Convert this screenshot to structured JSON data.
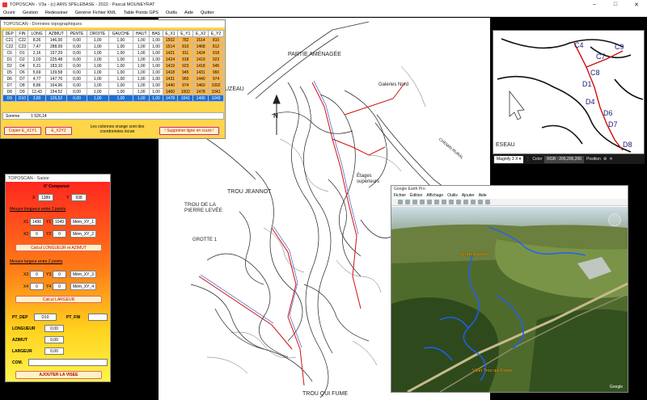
{
  "app": {
    "title": "TOPOSCAN - V3a - (c) ARIS SPELEBASE - 2022 - Pascal MOUNEYRAT",
    "menu": [
      "Ouvrir",
      "Gestion",
      "Redessiner",
      "Générer Fichier KML",
      "Table Points GPS",
      "Outils",
      "Aide",
      "Quitter"
    ]
  },
  "topo": {
    "title": "TOPOSCAN - Données topographiques",
    "columns": [
      "DEP",
      "FIN",
      "LONG",
      "AZIMUT",
      "PENTE",
      "DROITE",
      "GAUCHE",
      "HAUT",
      "BAS",
      "E_X1",
      "E_Y1",
      "E_X2",
      "E_Y2"
    ],
    "rows": [
      [
        "C21",
        "C22",
        "8,26",
        "146,00",
        "0,00",
        "1,00",
        "1,00",
        "1,00",
        "1,00",
        "1502",
        "782",
        "1514",
        "810"
      ],
      [
        "C22",
        "C23",
        "7,47",
        "288,09",
        "0,00",
        "1,00",
        "1,00",
        "1,00",
        "1,00",
        "1514",
        "810",
        "1468",
        "812"
      ],
      [
        "C6",
        "D1",
        "2,16",
        "157,29",
        "0,00",
        "1,00",
        "1,00",
        "1,00",
        "1,00",
        "1421",
        "911",
        "1424",
        "918"
      ],
      [
        "D1",
        "D2",
        "2,03",
        "225,48",
        "0,00",
        "1,00",
        "1,00",
        "1,00",
        "1,00",
        "1424",
        "918",
        "1419",
        "923"
      ],
      [
        "D2",
        "D4",
        "6,31",
        "183,10",
        "0,00",
        "1,00",
        "1,00",
        "1,00",
        "1,00",
        "1419",
        "923",
        "1418",
        "945"
      ],
      [
        "D5",
        "D6",
        "5,69",
        "139,58",
        "0,00",
        "1,00",
        "1,00",
        "1,00",
        "1,00",
        "1418",
        "945",
        "1431",
        "960"
      ],
      [
        "D6",
        "D7",
        "4,77",
        "147,76",
        "0,00",
        "1,00",
        "1,00",
        "1,00",
        "1,00",
        "1431",
        "960",
        "1440",
        "974"
      ],
      [
        "D7",
        "D8",
        "8,86",
        "164,96",
        "0,00",
        "1,00",
        "1,00",
        "1,00",
        "1,00",
        "1440",
        "974",
        "1460",
        "1002"
      ],
      [
        "D8",
        "D9",
        "12,43",
        "154,52",
        "0,00",
        "1,00",
        "1,00",
        "1,00",
        "1,00",
        "1460",
        "1002",
        "1478",
        "1041"
      ],
      [
        "D9",
        "D10",
        "3,80",
        "126,52",
        "0,00",
        "1,00",
        "1,00",
        "1,00",
        "1,00",
        "1478",
        "1041",
        "1490",
        "1049"
      ]
    ],
    "sum_label": "Somme",
    "sum_value": "1 526,14",
    "btn_copy": "Copier E_X1Y1",
    "btn_x2": "E_X2Y2",
    "note": "Les colonnes orange sont des coordonnées écran",
    "btn_delete": "! Supprimer ligne en cours !"
  },
  "saisie": {
    "title": "TOPOSCAN - Saisie",
    "compass": "0° Compensé",
    "x_label": "X",
    "x_value": "1389",
    "y_label": "Y",
    "y_value": "938",
    "section1": "Mesure longueur entre 2 points",
    "x1": "X1",
    "x1v": "1490",
    "y1": "Y1",
    "y1v": "1049",
    "btn_mem1": "Mém_XY_1",
    "x2": "X2",
    "x2v": "0",
    "y2": "Y2",
    "y2v": "0",
    "btn_mem2": "Mém_XY_2",
    "btn_calc1": "Calcul LONGUEUR et AZIMUT",
    "section2": "Mesure largeur entre 2 points",
    "x3": "X3",
    "x3v": "0",
    "y3": "Y3",
    "y3v": "0",
    "btn_mem3": "Mém_XY_3",
    "x4": "X4",
    "x4v": "0",
    "y4": "Y4",
    "y4v": "0",
    "btn_mem4": "Mém_XY_4",
    "btn_calc2": "Calcul LARGEUR",
    "pt_dep": "PT_DEP",
    "pt_dep_v": "D10",
    "pt_fin": "PT_FIN",
    "pt_fin_v": "",
    "longueur": "LONGUEUR",
    "longueur_v": "0,00",
    "azimut": "AZIMUT",
    "azimut_v": "0,00",
    "largeur": "LARGEUR",
    "largeur_v": "0,00",
    "com": "COM.",
    "btn_add": "AJOUTER LA VISEE"
  },
  "map": {
    "labels": [
      "PARTIE AMÉNAGÉE",
      "Galeries Nord",
      "TROU JEANNOT",
      "TROU DE LA PIERRE LEVÉE",
      "Étages supérieurs",
      "GROTTE 1",
      "TROU QUI FUME",
      "N",
      "DE",
      "UZEAU",
      "CHEMIN RURAL"
    ]
  },
  "mag": {
    "labels": [
      "C4",
      "C7",
      "C9",
      "C8",
      "D1",
      "D4",
      "D6",
      "D7",
      "D8",
      "ESEAU"
    ],
    "zoom": "Magnify 3 X",
    "color_label": "Color",
    "rgb": "RGB : 206,206,206",
    "position": "Position"
  },
  "earth": {
    "title": "Google Earth Pro",
    "menu": [
      "Fichier",
      "Édition",
      "Affichage",
      "Outils",
      "Ajouter",
      "Aide"
    ],
    "label_top": "Grotte Espace",
    "label_bottom": "Vilatt Trou qui Fume",
    "attribution": "Google"
  }
}
